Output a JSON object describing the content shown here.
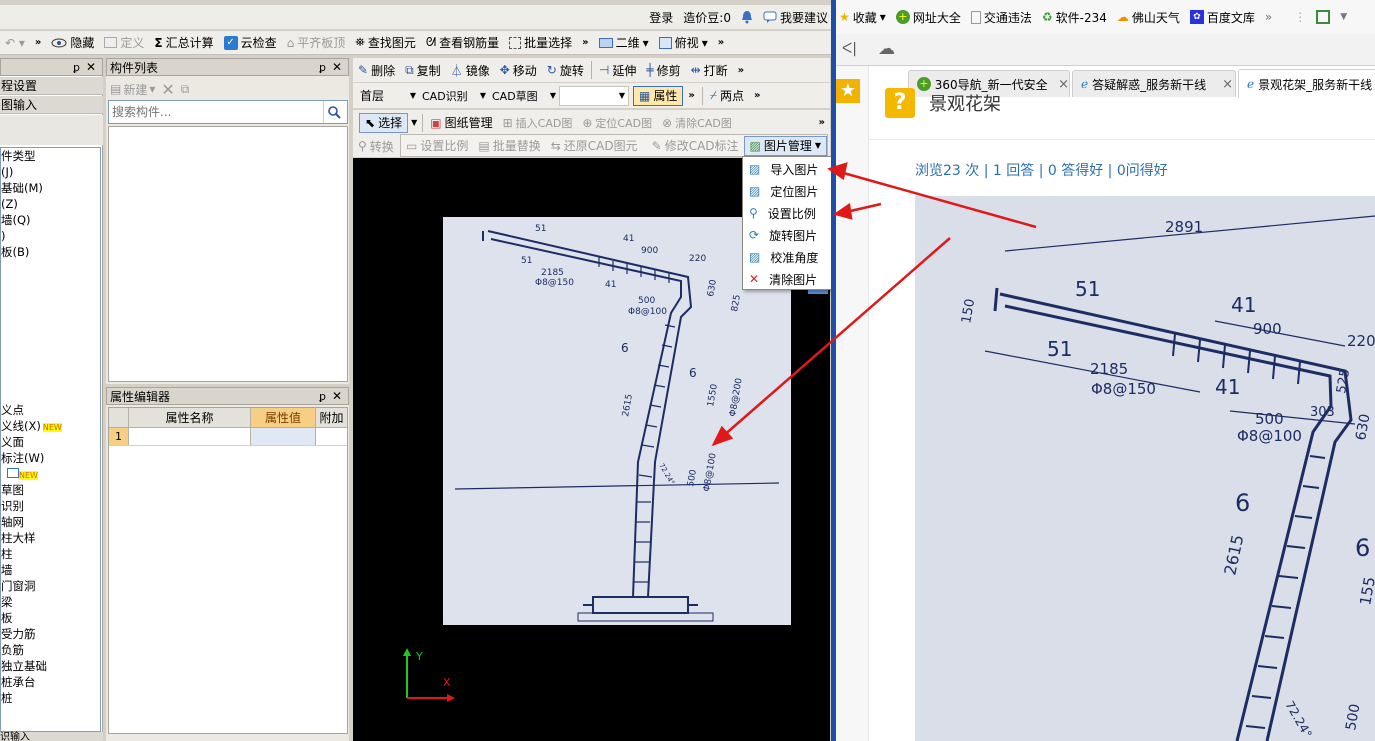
{
  "toolbar_top": {
    "login": "登录",
    "price": "造价豆:0",
    "feedback": "我要建议"
  },
  "toolbar1": {
    "hide": "隐藏",
    "define": "定义",
    "sum_calc": "汇总计算",
    "cloud_check": "云检查",
    "flat_top": "平齐板顶",
    "find_element": "查找图元",
    "view_rebar": "查看钢筋量",
    "batch_select": "批量选择",
    "view_2d": "二维",
    "view_top": "俯视"
  },
  "component_list": {
    "title": "构件列表",
    "new_label": "新建",
    "search_placeholder": "搜索构件..."
  },
  "property_editor": {
    "title": "属性编辑器",
    "headers": [
      "属性名称",
      "属性值",
      "附加"
    ],
    "row_num": "1"
  },
  "left_tree": {
    "items_top": [
      "程设置",
      "图输入"
    ],
    "items_mid": [
      "件类型",
      "(J)",
      "基础(M)",
      "(Z)",
      "墙(Q)",
      ")",
      "板(B)"
    ],
    "items_bottom": [
      "义点",
      "义线(X)",
      "义面",
      "标注(W)",
      "",
      "草图",
      "识别",
      "轴网",
      "柱大样",
      "柱",
      "墙",
      "门窗洞",
      "梁",
      "板",
      "受力筋",
      "负筋",
      "独立基础",
      "桩承台",
      "桩"
    ],
    "new_badge": "NEW",
    "bottom_cut": "识输入"
  },
  "edit_toolbar": {
    "delete": "删除",
    "copy": "复制",
    "mirror": "镜像",
    "move": "移动",
    "rotate": "旋转",
    "extend": "延伸",
    "trim": "修剪",
    "break": "打断"
  },
  "layer_toolbar": {
    "floor": "首层",
    "cad_recognize": "CAD识别",
    "cad_sketch": "CAD草图",
    "property": "属性",
    "two_point": "两点"
  },
  "cad_toolbar": {
    "select": "选择",
    "drawing_manage": "图纸管理",
    "insert_cad": "插入CAD图",
    "locate_cad": "定位CAD图",
    "clear_cad": "清除CAD图",
    "set_scale": "设置比例",
    "batch_replace": "批量替换",
    "restore_cad": "还原CAD图元",
    "modify_cad_label": "修改CAD标注",
    "image_manage": "图片管理",
    "convert": "转换"
  },
  "image_menu": {
    "items": [
      "导入图片",
      "定位图片",
      "设置比例",
      "旋转图片",
      "校准角度",
      "清除图片"
    ]
  },
  "drawing": {
    "labels": [
      "51",
      "41",
      "900",
      "220",
      "51",
      "2185",
      "Φ8@150",
      "41",
      "500",
      "Φ8@100",
      "630",
      "825",
      "6",
      "6",
      "2615",
      "1550",
      "Φ8@200",
      "500",
      "Φ8@100",
      "72.24°"
    ],
    "axis_y": "Y",
    "axis_x": "X"
  },
  "browser": {
    "bookmarks": [
      "收藏",
      "网址大全",
      "交通违法",
      "软件-234",
      "佛山天气",
      "百度文库"
    ],
    "tabs": [
      "360导航_新一代安全",
      "答疑解惑_服务新干线",
      "景观花架_服务新干线"
    ],
    "page_title": "景观花架",
    "stats": "浏览23 次 | 1 回答 | 0 答得好 | 0问得好",
    "photo_labels": [
      "2891",
      "51",
      "41",
      "900",
      "220",
      "150",
      "51",
      "2185",
      "Φ8@150",
      "41",
      "525",
      "500",
      "303",
      "Φ8@100",
      "630",
      "6",
      "6",
      "2615",
      "155",
      "72.24°",
      "500"
    ]
  },
  "colors": {
    "arrow_red": "#e01818",
    "canvas_bg": "#000000",
    "link_blue": "#2a6fb5",
    "toolbar_bg": "#f0eeea"
  }
}
